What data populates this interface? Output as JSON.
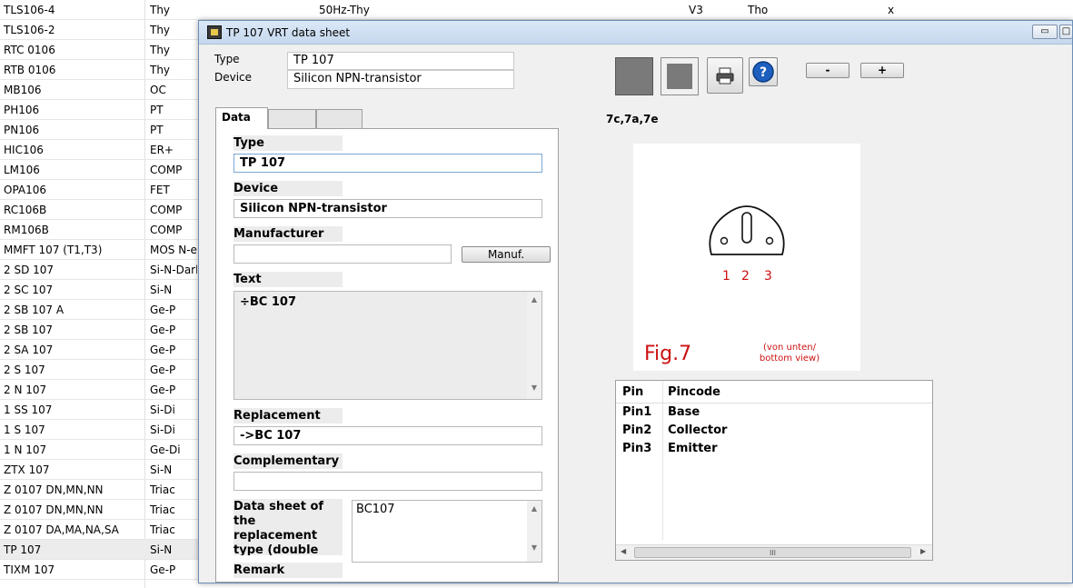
{
  "background_list": {
    "top_row": {
      "name": "TLS106-4",
      "type": "Thy",
      "desc": "50Hz-Thy",
      "c4": "V3",
      "c5": "Tho",
      "c6": "x"
    },
    "rows": [
      {
        "name": "TLS106-2",
        "type": "Thy"
      },
      {
        "name": "RTC 0106",
        "type": "Thy"
      },
      {
        "name": "RTB 0106",
        "type": "Thy"
      },
      {
        "name": "MB106",
        "type": "OC"
      },
      {
        "name": "PH106",
        "type": "PT"
      },
      {
        "name": "PN106",
        "type": "PT"
      },
      {
        "name": "HIC106",
        "type": "ER+"
      },
      {
        "name": "LM106",
        "type": "COMP"
      },
      {
        "name": "OPA106",
        "type": "FET"
      },
      {
        "name": "RC106B",
        "type": "COMP"
      },
      {
        "name": "RM106B",
        "type": "COMP"
      },
      {
        "name": "MMFT 107  (T1,T3)",
        "type": "MOS N-e"
      },
      {
        "name": "2 SD 107",
        "type": "Si-N-Darl"
      },
      {
        "name": "2 SC 107",
        "type": "Si-N"
      },
      {
        "name": "2 SB 107 A",
        "type": "Ge-P"
      },
      {
        "name": "2 SB 107",
        "type": "Ge-P"
      },
      {
        "name": "2 SA 107",
        "type": "Ge-P"
      },
      {
        "name": "2 S 107",
        "type": "Ge-P"
      },
      {
        "name": "2 N 107",
        "type": "Ge-P"
      },
      {
        "name": "1 SS 107",
        "type": "Si-Di"
      },
      {
        "name": "1 S 107",
        "type": "Si-Di"
      },
      {
        "name": "1 N 107",
        "type": "Ge-Di"
      },
      {
        "name": "ZTX 107",
        "type": "Si-N"
      },
      {
        "name": "Z 0107 DN,MN,NN",
        "type": "Triac"
      },
      {
        "name": "Z 0107 DN,MN,NN",
        "type": "Triac"
      },
      {
        "name": "Z 0107 DA,MA,NA,SA",
        "type": "Triac"
      },
      {
        "name": "TP 107",
        "type": "Si-N",
        "selected": true
      },
      {
        "name": "TIXM 107",
        "type": "Ge-P"
      }
    ]
  },
  "dialog": {
    "title": "TP 107 VRT data sheet",
    "header": {
      "type_label": "Type",
      "type_value": "TP 107",
      "device_label": "Device",
      "device_value": "Silicon NPN-transistor"
    },
    "tabs": [
      {
        "label": "Data"
      },
      {
        "label": ""
      },
      {
        "label": ""
      }
    ],
    "data_tab": {
      "type_label": "Type",
      "type_value": "TP 107",
      "device_label": "Device",
      "device_value": "Silicon NPN-transistor",
      "manufacturer_label": "Manufacturer",
      "manufacturer_value": "",
      "manuf_button": "Manuf.",
      "text_label": "Text",
      "text_value": "÷BC 107",
      "replacement_label": "Replacement",
      "replacement_value": "->BC 107",
      "complementary_label": "Complementary",
      "complementary_value": "",
      "datasheet_label": "Data sheet of the replacement type (double click!)",
      "datasheet_value": "BC107",
      "remark_label": "Remark"
    },
    "toolbar": {
      "minus_label": "-",
      "plus_label": "+"
    },
    "pin_codes_label": "7c,7a,7e",
    "figure": {
      "pins": [
        "1",
        "2",
        "3"
      ],
      "fig_label": "Fig.7",
      "note_line1": "(von unten/",
      "note_line2": "bottom view)"
    },
    "pin_table": {
      "headers": [
        "Pin",
        "Pincode"
      ],
      "rows": [
        {
          "pin": "Pin1",
          "code": "Base"
        },
        {
          "pin": "Pin2",
          "code": "Collector"
        },
        {
          "pin": "Pin3",
          "code": "Emitter"
        }
      ],
      "scroll_grip": "III"
    },
    "colors": {
      "accent_red": "#cc1111",
      "title_bar": "#c5d8ee",
      "help_blue": "#1d5fbf"
    }
  }
}
